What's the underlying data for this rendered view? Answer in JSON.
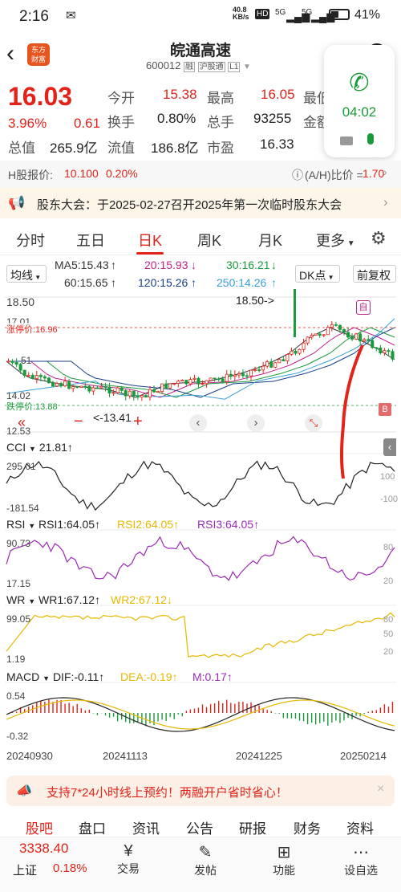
{
  "status": {
    "time": "2:16",
    "speed_top": "40.8",
    "speed_bottom": "KB/s",
    "hd": "HD",
    "sig1": "5G",
    "sig2": "5G",
    "battery": "41%"
  },
  "header": {
    "title": "皖通高速",
    "code": "600012",
    "tags": [
      "融",
      "沪股通",
      "L1"
    ],
    "logo_top": "东方",
    "logo_bottom": "财富"
  },
  "quote": {
    "price": "16.03",
    "pct": "3.96%",
    "change": "0.61",
    "total_mv_label": "总值",
    "total_mv": "265.9亿",
    "rows": [
      {
        "l1": "今开",
        "v1": "15.38",
        "l2": "最高",
        "v2": "16.05",
        "l3": "最低"
      },
      {
        "l1": "换手",
        "v1": "0.80%",
        "l2": "总手",
        "v2": "93255",
        "l3": "金额"
      },
      {
        "l1": "流值",
        "v1": "186.8亿",
        "l2": "市盈",
        "v2": "16.33"
      }
    ]
  },
  "hshare": {
    "label": "H股报价:",
    "price": "10.100",
    "pct": "0.20%",
    "ratio_label": "(A/H)比价 =",
    "ratio": "1.70"
  },
  "notice": {
    "text": "股东大会：于2025-02-27召开2025年第一次临时股东大会"
  },
  "tabs": [
    "分时",
    "五日",
    "日K",
    "周K",
    "月K",
    "更多"
  ],
  "active_tab": "日K",
  "ma": {
    "selector": "均线",
    "ma5": "MA5:15.43",
    "ma20": "20:15.93",
    "ma30": "30:16.21",
    "ma60": "60:15.65",
    "ma120": "120:15.26",
    "ma250": "250:14.26",
    "dk": "DK点",
    "adj": "前复权"
  },
  "kline": {
    "y_top": "18.50",
    "y2": "17.01",
    "y3": "51",
    "y4": "14.02",
    "y_bottom": "12.53",
    "limit_up": "涨停价:16.96",
    "limit_down": "跌停价:13.88",
    "max_label": "18.50->",
    "min_label": "<-13.41",
    "zi": "自",
    "b": "B"
  },
  "cci": {
    "name": "CCI",
    "value": "21.81",
    "top": "295.01",
    "bottom": "-181.54",
    "r1": "100",
    "r2": "-100"
  },
  "rsi": {
    "name": "RSI",
    "v1": "RSI1:64.05",
    "v2": "RSI2:64.05",
    "v3": "RSI3:64.05",
    "top": "90.73",
    "bottom": "17.15",
    "r1": "80",
    "r2": "20"
  },
  "wr": {
    "name": "WR",
    "v1": "WR1:67.12",
    "v2": "WR2:67.12",
    "top": "99.05",
    "bottom": "1.19",
    "r1": "80",
    "r2": "50",
    "r3": "20"
  },
  "macd": {
    "name": "MACD",
    "dif": "DIF:-0.11",
    "dea": "DEA:-0.19",
    "m": "M:0.17",
    "top": "0.54",
    "bottom": "-0.32"
  },
  "dates": [
    "20240930",
    "20241113",
    "20241225",
    "20250214"
  ],
  "promo": {
    "text": "支持7*24小时线上预约！两融开户省时省心！"
  },
  "bottom_tabs": [
    "股吧",
    "盘口",
    "资讯",
    "公告",
    "研报",
    "财务",
    "资料"
  ],
  "bottom": {
    "index_val": "3338.40",
    "index_name": "上证",
    "index_pct": "0.18%",
    "nav": [
      "交易",
      "发帖",
      "功能",
      "设自选"
    ]
  },
  "call": {
    "time": "04:02"
  },
  "colors": {
    "red": "#e2231a",
    "green": "#1a9a3a",
    "ma5": "#333333",
    "ma20": "#c0238c",
    "ma30": "#1a9a3a",
    "ma60": "#333333",
    "ma120": "#1a3e8c",
    "ma250": "#3aa0d8",
    "rsi2": "#e6b800",
    "rsi3": "#9b2bb5"
  }
}
